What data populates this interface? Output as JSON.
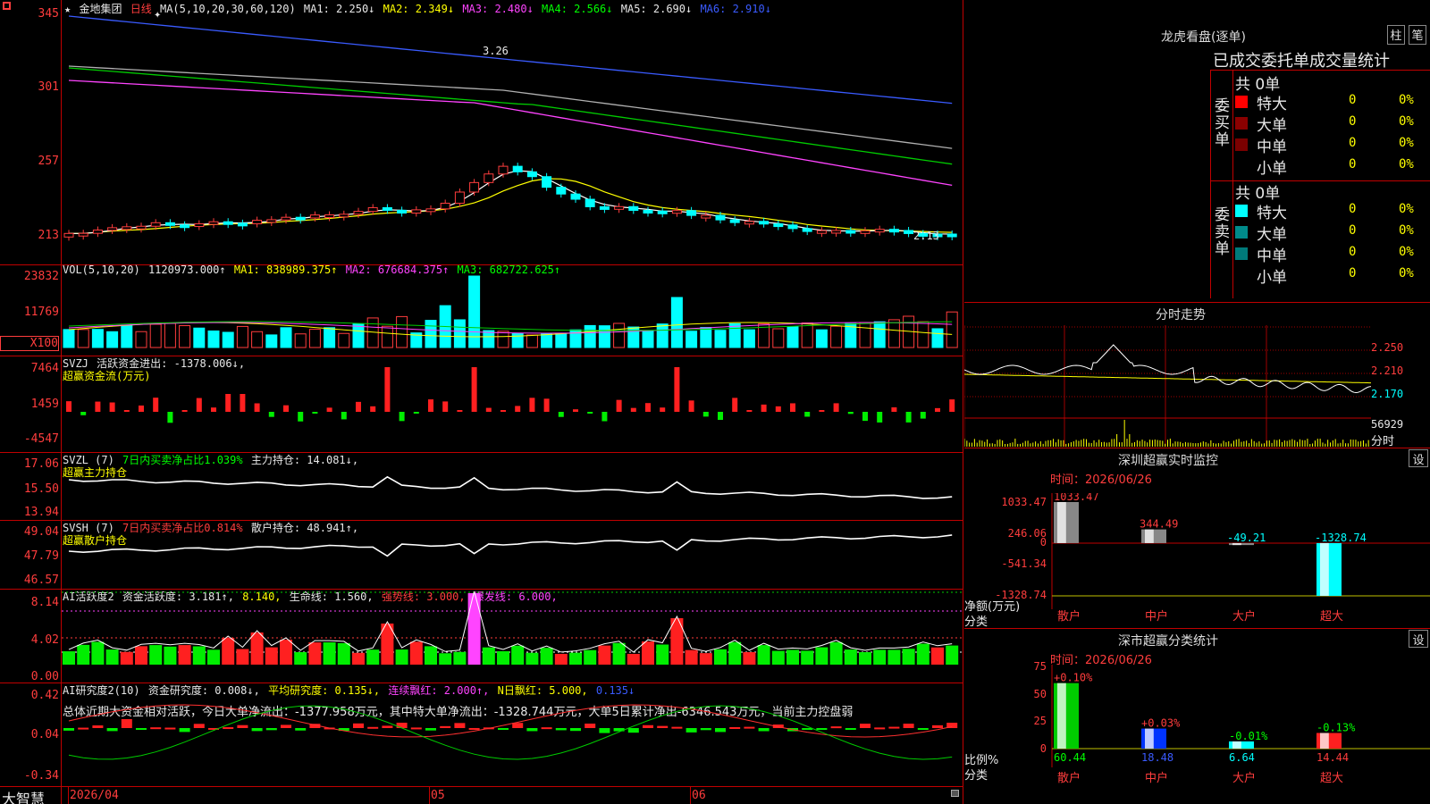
{
  "app": {
    "name": "大智慧",
    "stock_name": "金地集团",
    "period": "日线",
    "star": "★",
    "plus": "✦"
  },
  "main_chart": {
    "ma_header": "MA(5,10,20,30,60,120)",
    "ma_values": [
      {
        "label": "MA1:",
        "value": "2.250↓",
        "color": "#e8e8e8"
      },
      {
        "label": "MA2:",
        "value": "2.349↓",
        "color": "#ffff00"
      },
      {
        "label": "MA3:",
        "value": "2.480↓",
        "color": "#ff44ff"
      },
      {
        "label": "MA4:",
        "value": "2.566↓",
        "color": "#00ff00"
      },
      {
        "label": "MA5:",
        "value": "2.690↓",
        "color": "#e8e8e8"
      },
      {
        "label": "MA6:",
        "value": "2.910↓",
        "color": "#3a5bff"
      }
    ],
    "y_ticks": [
      "345",
      "301",
      "257",
      "213"
    ],
    "high_label": "3.26",
    "low_label": "2.13"
  },
  "volume": {
    "header": "VOL(5,10,20)",
    "vol": "1120973.000↑",
    "ma1": "MA1: 838989.375↑",
    "ma2": "MA2: 676684.375↑",
    "ma3": "MA3: 682722.625↑",
    "y_ticks": [
      "23832",
      "11769",
      "X100"
    ]
  },
  "svzj": {
    "header": "SVZJ",
    "label": "活跃资金进出: -1378.006↓,",
    "sub": "超赢资金流(万元)",
    "y_ticks": [
      "7464",
      "1459",
      "-4547"
    ]
  },
  "svzl": {
    "header": "SVZL (7)",
    "ratio": "7日内买卖净占比1.039%",
    "hold": "主力持仓: 14.081↓,",
    "sub": "超赢主力持仓",
    "y_ticks": [
      "17.06",
      "15.50",
      "13.94"
    ]
  },
  "svsh": {
    "header": "SVSH (7)",
    "ratio": "7日内买卖净占比0.814%",
    "hold": "散户持仓: 48.941↑,",
    "sub": "超赢散户持仓",
    "y_ticks": [
      "49.04",
      "47.79",
      "46.57"
    ]
  },
  "ai_active": {
    "header": "AI活跃度2",
    "active": "资金活跃度: 3.181↑,",
    "v2": "8.140,",
    "life": "生命线: 1.560,",
    "strong": "强势线: 3.000,",
    "burst": "爆发线: 6.000,",
    "y_ticks": [
      "8.14",
      "4.02",
      "0.00"
    ]
  },
  "ai_research": {
    "header": "AI研究度2(10)",
    "research": "资金研究度: 0.008↓,",
    "avg": "平均研究度: 0.135↓,",
    "cont": "连续飘红: 2.000↑,",
    "nday": "N日飘红: 5.000,",
    "last": "0.135↓",
    "summary": "总体近期大资金相对活跃，今日大单净流出：-1377.958万元，其中特大单净流出：-1328.744万元，大单5日累计净出-6346.543万元，当前主力控盘弱",
    "y_ticks": [
      "0.42",
      "0.04",
      "-0.34"
    ]
  },
  "x_axis": {
    "labels": [
      "2026/04",
      "05",
      "06"
    ]
  },
  "dragon": {
    "title": "龙虎看盘(逐单)",
    "btn1": "柱",
    "btn2": "笔",
    "subtitle": "已成交委托单成交量统计",
    "buy": {
      "side": "委买单",
      "total": "共 0单",
      "rows": [
        {
          "label": "特大",
          "count": "0",
          "pct": "0%",
          "color": "#ff0000"
        },
        {
          "label": "大单",
          "count": "0",
          "pct": "0%",
          "color": "#8b0000"
        },
        {
          "label": "中单",
          "count": "0",
          "pct": "0%",
          "color": "#7a0000"
        },
        {
          "label": "小单",
          "count": "0",
          "pct": "0%",
          "color": "#000000"
        }
      ]
    },
    "sell": {
      "side": "委卖单",
      "total": "共 0单",
      "rows": [
        {
          "label": "特大",
          "count": "0",
          "pct": "0%",
          "color": "#00ffff"
        },
        {
          "label": "大单",
          "count": "0",
          "pct": "0%",
          "color": "#008b8b"
        },
        {
          "label": "中单",
          "count": "0",
          "pct": "0%",
          "color": "#007a7a"
        },
        {
          "label": "小单",
          "count": "0",
          "pct": "0%",
          "color": "#000000"
        }
      ]
    }
  },
  "intraday": {
    "title": "分时走势",
    "prices": [
      "2.250",
      "2.210",
      "2.170"
    ],
    "vol": "56929",
    "vol_label": "分时"
  },
  "monitor": {
    "title": "深圳超赢实时监控",
    "set": "设",
    "time": "时间：2026/06/26",
    "y_ticks": [
      "1033.47",
      "246.06",
      "0",
      "-541.34",
      "-1328.74"
    ],
    "ylabel": "净额(万元)",
    "xlabel": "分类",
    "chart_data": {
      "type": "bar",
      "categories": [
        "散户",
        "中户",
        "大户",
        "超大"
      ],
      "values": [
        1033.47,
        344.49,
        -49.21,
        -1328.74
      ],
      "labels": [
        "1033.47",
        "344.49",
        "-49.21",
        "-1328.74"
      ],
      "ylim": [
        -1328.74,
        1033.47
      ]
    }
  },
  "classify": {
    "title": "深市超赢分类统计",
    "set": "设",
    "time": "时间：2026/06/26",
    "y_ticks": [
      "75",
      "50",
      "25",
      "0"
    ],
    "ylabel": "比例%",
    "xlabel": "分类",
    "chart_data": {
      "type": "bar",
      "categories": [
        "散户",
        "中户",
        "大户",
        "超大"
      ],
      "values": [
        60.44,
        18.48,
        6.64,
        14.44
      ],
      "changes": [
        "+0.10%",
        "+0.03%",
        "-0.01%",
        "-0.13%"
      ],
      "value_labels": [
        "60.44",
        "18.48",
        "6.64",
        "14.44"
      ],
      "ylim": [
        0,
        75
      ]
    }
  }
}
